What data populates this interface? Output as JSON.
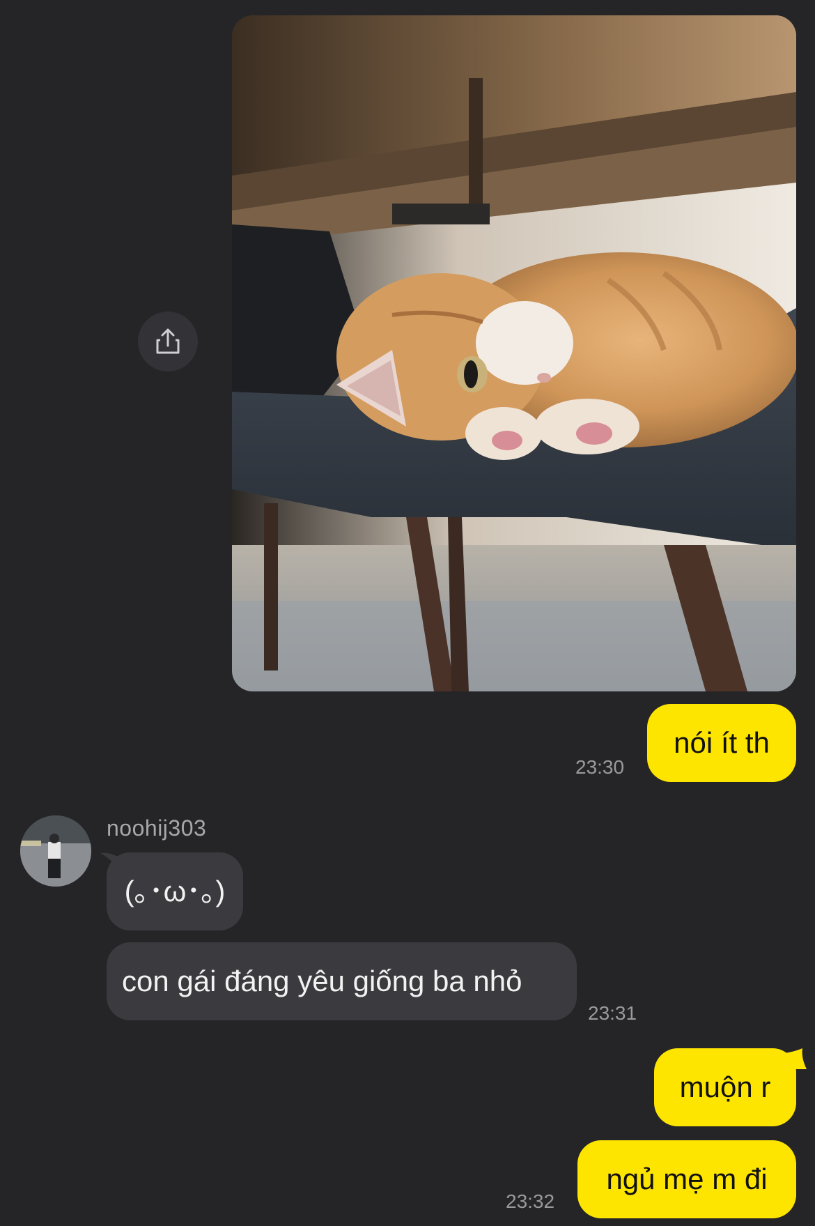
{
  "app": {
    "accent_color": "#fee500",
    "background_color": "#252528",
    "incoming_bubble_color": "#3b3b3f"
  },
  "shared_photo": {
    "subject": "orange cat lying on a grey chair under a table",
    "share_icon": "share-icon"
  },
  "messages": [
    {
      "from": "me",
      "text": "nói ít th",
      "time": "23:30"
    },
    {
      "from": "other",
      "sender": "noohij303",
      "text": "(｡･ω･｡)"
    },
    {
      "from": "other",
      "text": "con gái đáng yêu giống ba nhỏ",
      "time": "23:31"
    },
    {
      "from": "me",
      "text": "muộn r"
    },
    {
      "from": "me",
      "text": "ngủ mẹ m đi",
      "time": "23:32"
    }
  ]
}
